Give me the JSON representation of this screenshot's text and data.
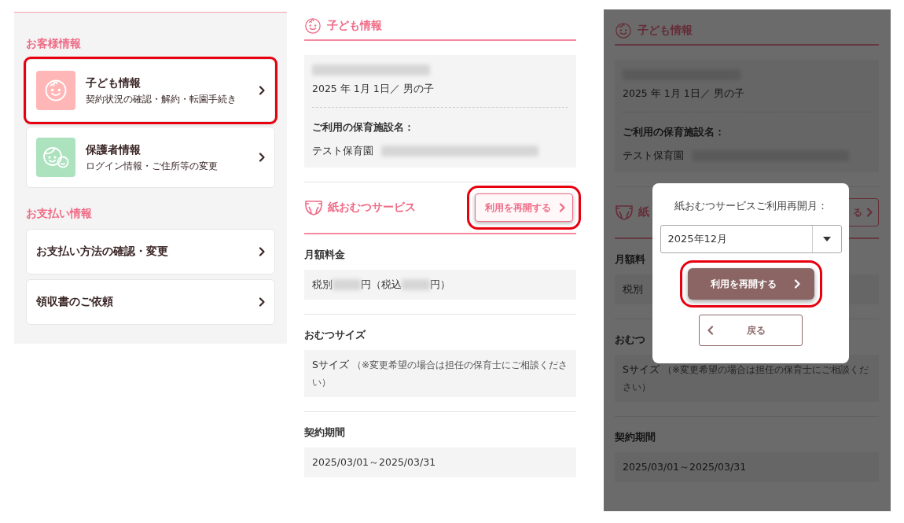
{
  "menu": {
    "sections": [
      {
        "title": "お客様情報",
        "items": [
          {
            "kind": "child",
            "title": "子ども情報",
            "subtitle": "契約状況の確認・解約・転園手続き",
            "highlighted": true
          },
          {
            "kind": "guardian",
            "title": "保護者情報",
            "subtitle": "ログイン情報・ご住所等の変更",
            "highlighted": false
          }
        ]
      },
      {
        "title": "お支払い情報",
        "items": [
          {
            "kind": "plain",
            "title": "お支払い方法の確認・変更",
            "highlighted": false
          },
          {
            "kind": "plain",
            "title": "領収書のご依頼",
            "highlighted": false
          }
        ]
      }
    ]
  },
  "detail_panel": {
    "heading": "子ども情報",
    "birth": "2025 年 1月 1日／ 男の子",
    "facility_label": "ご利用の保育施設名：",
    "facility": "テスト保育園",
    "diaper_heading": "紙おむつサービス",
    "resume_button": {
      "label": "利用を再開する",
      "highlighted": true
    },
    "fields": [
      {
        "kind": "fee",
        "label": "月額料金",
        "parts": [
          "税別",
          "円（税込",
          "円）"
        ]
      },
      {
        "kind": "text",
        "label": "おむつサイズ",
        "value": "Sサイズ",
        "note": "（※変更希望の場合は担任の保育士にご相談ください）"
      },
      {
        "kind": "text",
        "label": "契約期間",
        "value": "2025/03/01～2025/03/31"
      }
    ]
  },
  "dimmed_panel": {
    "dimmed": true,
    "heading": "子ども情報",
    "birth": "2025 年 1月 1日／ 男の子",
    "facility_label": "ご利用の保育施設名：",
    "facility": "テスト保育園",
    "diaper_heading": "紙",
    "resume_button": {
      "label": "る",
      "highlighted": false
    },
    "fields": [
      {
        "kind": "fee",
        "label": "月額料",
        "parts": [
          "税別"
        ]
      },
      {
        "kind": "text",
        "label": "おむつ",
        "value": "Sサイズ",
        "note": "（※変更希望の場合は担任の保育士にご相談ください）"
      },
      {
        "kind": "text",
        "label": "契約期間",
        "value": "2025/03/01～2025/03/31"
      }
    ],
    "modal": {
      "title": "紙おむつサービスご利用再開月：",
      "select_value": "2025年12月",
      "confirm": {
        "label": "利用を再開する",
        "highlighted": true
      },
      "back": {
        "label": "戻る"
      }
    }
  }
}
